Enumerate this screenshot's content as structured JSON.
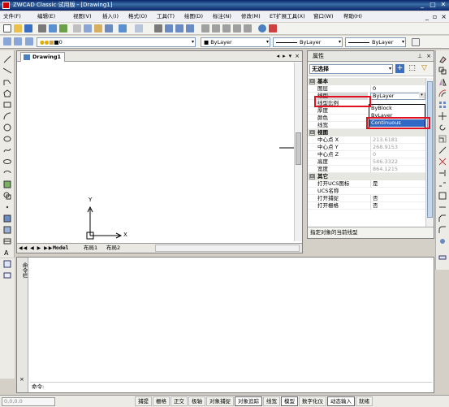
{
  "window": {
    "title": "ZWCAD Classic 试用版 - [Drawing1]",
    "controls": [
      "_",
      "□",
      "✕"
    ]
  },
  "menu": {
    "items": [
      "文件(F)",
      "编辑(E)",
      "视图(V)",
      "插入(I)",
      "格式(O)",
      "工具(T)",
      "绘图(D)",
      "标注(N)",
      "修改(M)",
      "ET扩展工具(X)",
      "窗口(W)",
      "帮助(H)"
    ],
    "doc_controls": [
      "_",
      "▫",
      "×"
    ]
  },
  "toolbar": {
    "layer_value": "0",
    "color_value": "ByLayer",
    "linetype_value": "ByLayer",
    "lineweight_value": "ByLayer"
  },
  "drawing": {
    "tab_title": "Drawing1",
    "tab_controls": [
      "◂",
      "▸",
      "▾",
      "×"
    ],
    "axis_x": "X",
    "axis_y": "Y",
    "layout_nav": "◀◀ ◀ ▶ ▶▶",
    "layout_tabs": [
      "Model",
      "布局1",
      "布局2"
    ]
  },
  "properties": {
    "title": "属性",
    "header_controls": [
      "⊥",
      "×"
    ],
    "selection": "无选择",
    "categories": [
      {
        "label": "基本",
        "box": "⊟",
        "rows": [
          {
            "key": "图层",
            "value": "0",
            "gray": false
          },
          {
            "key": "线型",
            "value": "ByLayer",
            "gray": false
          },
          {
            "key": "线型比例",
            "value": "",
            "gray": false
          },
          {
            "key": "厚度",
            "value": "",
            "gray": false
          },
          {
            "key": "颜色",
            "value": "",
            "gray": false
          },
          {
            "key": "线宽",
            "value": "—— ByLayer",
            "gray": false
          }
        ]
      },
      {
        "label": "视图",
        "box": "⊟",
        "rows": [
          {
            "key": "中心点 X",
            "value": "213.6181",
            "gray": true
          },
          {
            "key": "中心点 Y",
            "value": "268.9153",
            "gray": true
          },
          {
            "key": "中心点 Z",
            "value": "0",
            "gray": true
          },
          {
            "key": "高度",
            "value": "546.3322",
            "gray": true
          },
          {
            "key": "宽度",
            "value": "864.1215",
            "gray": true
          }
        ]
      },
      {
        "label": "其它",
        "box": "⊟",
        "rows": [
          {
            "key": "打开UCS图标",
            "value": "是",
            "gray": false
          },
          {
            "key": "UCS名称",
            "value": "",
            "gray": false
          },
          {
            "key": "打开捕捉",
            "value": "否",
            "gray": false
          },
          {
            "key": "打开栅格",
            "value": "否",
            "gray": false
          }
        ]
      }
    ],
    "linetype_options": [
      "ByBlock",
      "ByLayer",
      "Continuous"
    ],
    "selected_option": "Continuous",
    "description": "指定对象的当前线型"
  },
  "command": {
    "side_label": "命令栏",
    "close": "×",
    "prompt": "命令:"
  },
  "status": {
    "coords": "0,0,0.0",
    "buttons": [
      {
        "label": "捕提",
        "on": false
      },
      {
        "label": "栅格",
        "on": false
      },
      {
        "label": "正交",
        "on": false
      },
      {
        "label": "极轴",
        "on": false
      },
      {
        "label": "对象捕捉",
        "on": false
      },
      {
        "label": "对象追踪",
        "on": true
      },
      {
        "label": "线宽",
        "on": false
      },
      {
        "label": "模型",
        "on": true
      },
      {
        "label": "数字化仪",
        "on": false
      },
      {
        "label": "动态输入",
        "on": true
      },
      {
        "label": "就绪",
        "on": false
      }
    ]
  },
  "colors": {
    "highlight": "#3169c6",
    "annotation": "#e01020",
    "title_bar": "#0a246a"
  }
}
